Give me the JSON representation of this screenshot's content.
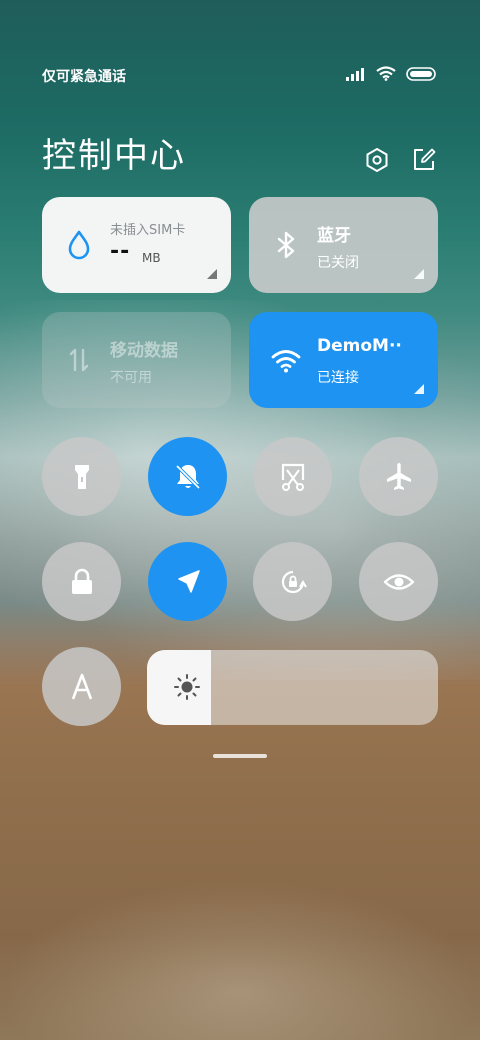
{
  "status_bar": {
    "carrier": "仅可紧急通话",
    "icons": [
      "signal-icon",
      "wifi-icon",
      "battery-icon"
    ]
  },
  "header": {
    "title": "控制中心",
    "icons": [
      "settings-icon",
      "edit-icon"
    ]
  },
  "tiles": {
    "data_usage": {
      "label": "未插入SIM卡",
      "value": "--",
      "unit": "MB",
      "icon": "water-drop-icon"
    },
    "bluetooth": {
      "title": "蓝牙",
      "status": "已关闭",
      "icon": "bluetooth-icon"
    },
    "mobile_data": {
      "title": "移动数据",
      "status": "不可用",
      "icon": "mobile-data-icon"
    },
    "wifi": {
      "title": "DemoM··",
      "status": "已连接",
      "icon": "wifi-icon"
    }
  },
  "toggles": [
    {
      "name": "flashlight",
      "icon": "flashlight-icon",
      "active": false
    },
    {
      "name": "silent",
      "icon": "bell-off-icon",
      "active": true
    },
    {
      "name": "screenshot",
      "icon": "screenshot-scissors-icon",
      "active": false
    },
    {
      "name": "airplane",
      "icon": "airplane-icon",
      "active": false
    },
    {
      "name": "lock",
      "icon": "lock-icon",
      "active": false
    },
    {
      "name": "location",
      "icon": "location-arrow-icon",
      "active": true
    },
    {
      "name": "rotation-lock",
      "icon": "rotation-lock-icon",
      "active": false
    },
    {
      "name": "reading-mode",
      "icon": "eye-icon",
      "active": false
    },
    {
      "name": "font-size",
      "icon": "font-a-icon",
      "active": false
    }
  ],
  "brightness": {
    "level_fraction": 0.22,
    "icon": "sun-icon"
  },
  "colors": {
    "accent": "#1e93f1",
    "inactive": "#c8c8c8",
    "tile_light": "#f3f5f5"
  }
}
